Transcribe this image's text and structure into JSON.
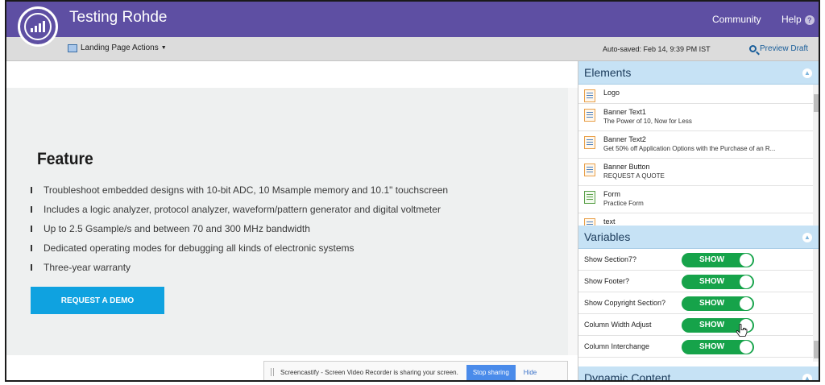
{
  "header": {
    "title": "Testing Rohde",
    "community": "Community",
    "help": "Help",
    "help_icon": "?",
    "brand_color": "#5e4fa3"
  },
  "toolbar": {
    "actions_label": "Landing Page Actions",
    "autosaved": "Auto-saved: Feb 14, 9:39 PM IST",
    "preview": "Preview Draft"
  },
  "canvas": {
    "feature_title": "Feature",
    "features": [
      "Troubleshoot embedded designs with 10-bit ADC, 10 Msample memory and 10.1\" touchscreen",
      "Includes a logic analyzer, protocol analyzer, waveform/pattern generator and digital voltmeter",
      "Up to 2.5 Gsample/s and between 70 and 300 MHz bandwidth",
      "Dedicated operating modes for debugging all kinds of electronic systems",
      "Three-year warranty"
    ],
    "demo_button": "REQUEST A DEMO",
    "accent_color": "#0fa2e0"
  },
  "share_bar": {
    "text": "Screencastify - Screen Video Recorder is sharing your screen.",
    "stop": "Stop sharing",
    "hide": "Hide"
  },
  "elements_panel": {
    "title": "Elements",
    "items": [
      {
        "name": "Logo",
        "sub": ""
      },
      {
        "name": "Banner Text1",
        "sub": "The Power of 10, Now for Less"
      },
      {
        "name": "Banner Text2",
        "sub": "Get 50% off Application Options with the Purchase of an R..."
      },
      {
        "name": "Banner Button",
        "sub": "REQUEST A QUOTE"
      },
      {
        "name": "Form",
        "sub": "Practice Form"
      },
      {
        "name": "text",
        "sub": ""
      }
    ]
  },
  "variables_panel": {
    "title": "Variables",
    "rows": [
      {
        "label": "Show Section7?",
        "toggle": "SHOW"
      },
      {
        "label": "Show Footer?",
        "toggle": "SHOW"
      },
      {
        "label": "Show Copyright Section?",
        "toggle": "SHOW"
      },
      {
        "label": "Column Width Adjust",
        "toggle": "SHOW"
      },
      {
        "label": "Column Interchange",
        "toggle": "SHOW"
      }
    ],
    "toggle_color": "#16a34a"
  },
  "dynamic_panel": {
    "title": "Dynamic Content"
  }
}
